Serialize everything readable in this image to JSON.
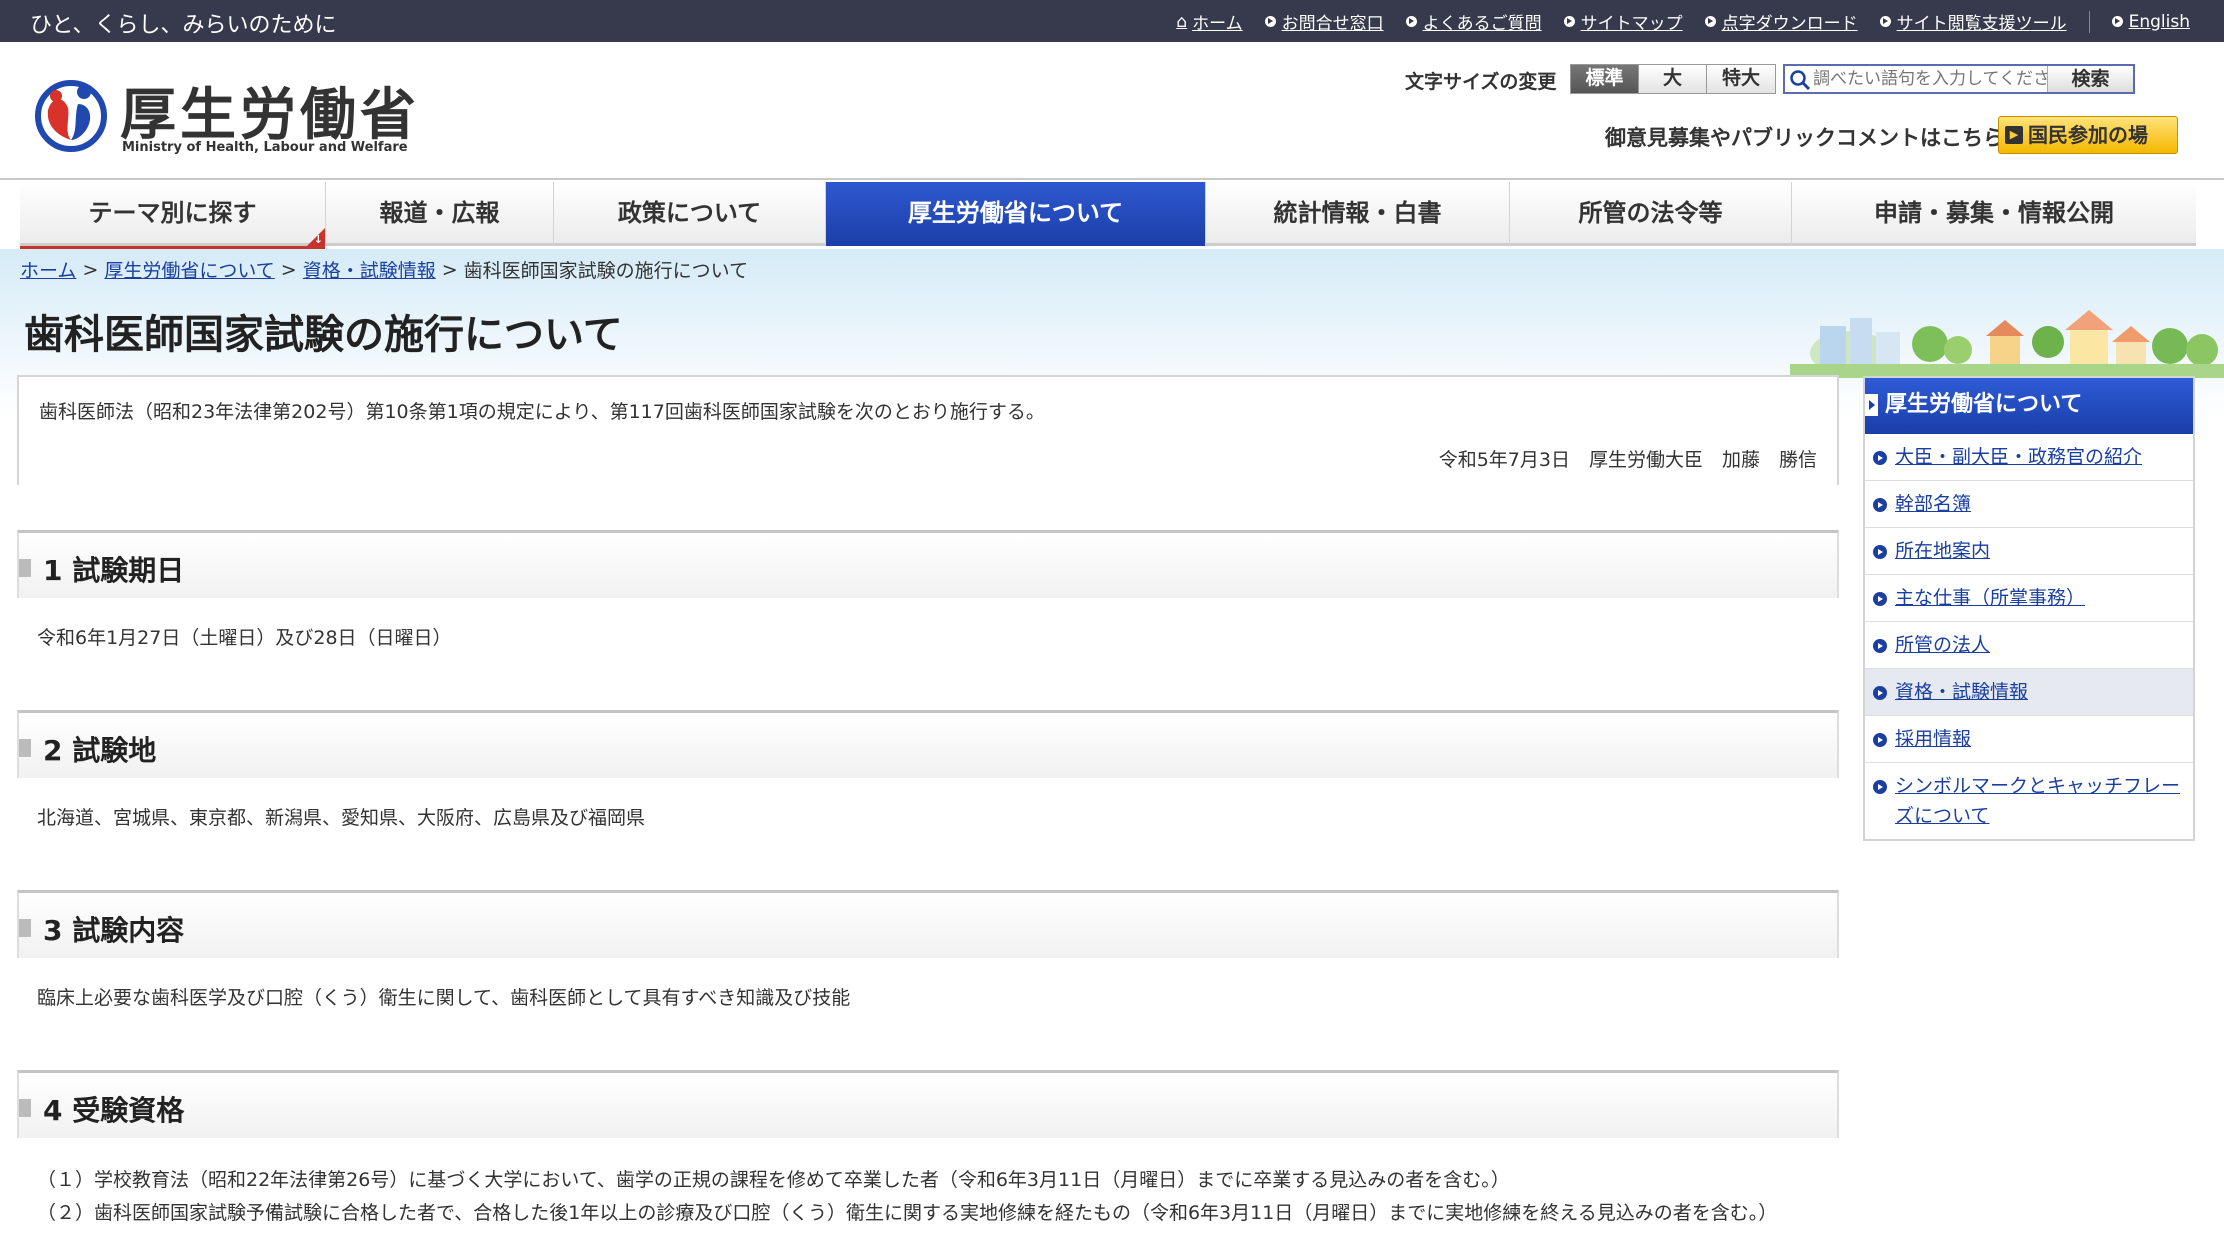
{
  "topbar": {
    "tagline": "ひと、くらし、みらいのために",
    "links": [
      "ホーム",
      "お問合せ窓口",
      "よくあるご質問",
      "サイトマップ",
      "点字ダウンロード",
      "サイト閲覧支援ツール",
      "English"
    ]
  },
  "header": {
    "logo_title": "厚生労働省",
    "logo_subtitle": "Ministry of Health, Labour and Welfare",
    "font_size_label": "文字サイズの変更",
    "font_size_options": [
      "標準",
      "大",
      "特大"
    ],
    "search_placeholder": "調べたい語句を入力してください",
    "search_button": "検索",
    "opinion_text": "御意見募集やパブリックコメントはこちら",
    "participation_button": "国民参加の場"
  },
  "nav": {
    "items": [
      "テーマ別に探す",
      "報道・広報",
      "政策について",
      "厚生労働省について",
      "統計情報・白書",
      "所管の法令等",
      "申請・募集・情報公開"
    ],
    "active_index": 3
  },
  "breadcrumb": [
    "ホーム",
    "厚生労働省について",
    "資格・試験情報",
    "歯科医師国家試験の施行について"
  ],
  "page_title": "歯科医師国家試験の施行について",
  "intro": {
    "text": "歯科医師法（昭和23年法律第202号）第10条第1項の規定により、第117回歯科医師国家試験を次のとおり施行する。",
    "signature": "令和5年7月3日　厚生労働大臣　加藤　勝信"
  },
  "sections": [
    {
      "title": "1 試験期日",
      "body": [
        "令和6年1月27日（土曜日）及び28日（日曜日）"
      ]
    },
    {
      "title": "2 試験地",
      "body": [
        "北海道、宮城県、東京都、新潟県、愛知県、大阪府、広島県及び福岡県"
      ]
    },
    {
      "title": "3 試験内容",
      "body": [
        "臨床上必要な歯科医学及び口腔（くう）衛生に関して、歯科医師として具有すべき知識及び技能"
      ]
    },
    {
      "title": "4 受験資格",
      "body": [
        "（１）学校教育法（昭和22年法律第26号）に基づく大学において、歯学の正規の課程を修めて卒業した者（令和6年3月11日（月曜日）までに卒業する見込みの者を含む。）",
        "（２）歯科医師国家試験予備試験に合格した者で、合格した後1年以上の診療及び口腔（くう）衛生に関する実地修練を経たもの（令和6年3月11日（月曜日）までに実地修練を終える見込みの者を含む。）"
      ]
    }
  ],
  "sidebar": {
    "title": "厚生労働省について",
    "items": [
      "大臣・副大臣・政務官の紹介",
      "幹部名簿",
      "所在地案内",
      "主な仕事（所掌事務）",
      "所管の法人",
      "資格・試験情報",
      "採用情報",
      "シンボルマークとキャッチフレーズについて"
    ],
    "current_index": 5
  },
  "colors": {
    "topbar": "#363a4c",
    "nav_active": "#1b3fa8",
    "link": "#1a3fa0",
    "accent_red": "#c8342b",
    "button_yellow": "#f5b800"
  }
}
